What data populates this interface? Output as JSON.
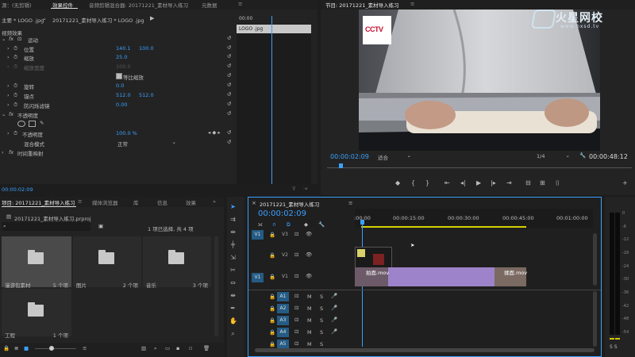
{
  "top_tabs": {
    "source_label": "源：(无剪辑)",
    "effect_controls": "效果控件",
    "audio_mixer": "音频剪辑混合器: 20171221_素材导入练习",
    "metadata": "元数据"
  },
  "effect_controls": {
    "master_path": "主要 * LOGO .jpg",
    "clip_path": "20171221_素材导入练习 * LOGO .jpg",
    "timecode_ruler": "00:00",
    "clip_bar_label": "LOGO .jpg",
    "section_video": "视频效果",
    "motion": "运动",
    "position_label": "位置",
    "position_x": "140.1",
    "position_y": "100.0",
    "scale_label": "缩放",
    "scale_value": "25.0",
    "scale_width_label": "缩放宽度",
    "scale_width_value": "100.0",
    "uniform_scale": "等比缩放",
    "rotation_label": "旋转",
    "rotation_value": "0.0",
    "anchor_label": "锚点",
    "anchor_x": "512.0",
    "anchor_y": "512.0",
    "antiflicker_label": "防闪烁滤镜",
    "antiflicker_value": "0.00",
    "opacity_section": "不透明度",
    "opacity_label": "不透明度",
    "opacity_value": "100.0 %",
    "blend_label": "混合模式",
    "blend_value": "正常",
    "time_remap": "时间重映射",
    "bottom_timecode": "00:00:02:09"
  },
  "program_monitor": {
    "title": "节目: 20171221_素材导入练习",
    "overlay_logo": "CCTV",
    "brand_name": "火星网校",
    "brand_url": "www.hxsd.tv",
    "current_timecode": "00:00:02:09",
    "fit_label": "适合",
    "resolution": "1/4",
    "duration_timecode": "00:00:48:12",
    "playhead_percent": 4
  },
  "project_panel": {
    "tabs": [
      "项目: 20171221_素材导入练习",
      "媒体浏览器",
      "库",
      "信息",
      "效果"
    ],
    "project_file": "20171221_素材导入练习.prproj",
    "selection_info": "1 项已选择, 共 4 项",
    "bins": [
      {
        "name": "漫游包素材",
        "count": "5 个项"
      },
      {
        "name": "图片",
        "count": "2 个项"
      },
      {
        "name": "音乐",
        "count": "3 个项"
      },
      {
        "name": "工程",
        "count": "1 个项"
      }
    ]
  },
  "timeline": {
    "sequence_name": "20171221_素材导入练习",
    "timecode": "00:00:02:09",
    "ruler_ticks": [
      ":00:00",
      "00:00:15:00",
      "00:00:30:00",
      "00:00:45:00",
      "00:01:00:00"
    ],
    "video_tracks": [
      {
        "src": "V1",
        "label": "V3"
      },
      {
        "src": "",
        "label": "V2"
      },
      {
        "src": "V1",
        "label": "V1"
      }
    ],
    "audio_tracks": [
      {
        "label": "A1",
        "m": "M",
        "s": "S"
      },
      {
        "label": "A2",
        "m": "M",
        "s": "S"
      },
      {
        "label": "A3",
        "m": "M",
        "s": "S"
      },
      {
        "label": "A4",
        "m": "M",
        "s": "S"
      },
      {
        "label": "A5",
        "m": "M",
        "s": "S"
      }
    ],
    "clip_v1_a": "拍面.mov",
    "clip_v1_b": "揉面.mov"
  },
  "meter": {
    "labels": [
      "0",
      "-6",
      "-12",
      "-18",
      "-24",
      "-30",
      "-36",
      "-42",
      "-48",
      "-54"
    ],
    "solo": "S  S"
  },
  "colors": {
    "accent_blue": "#3aa0ff",
    "clip_blue": "#4a7b9e",
    "clip_purple": "#9d83c9",
    "playhead": "#3aa0ff"
  }
}
